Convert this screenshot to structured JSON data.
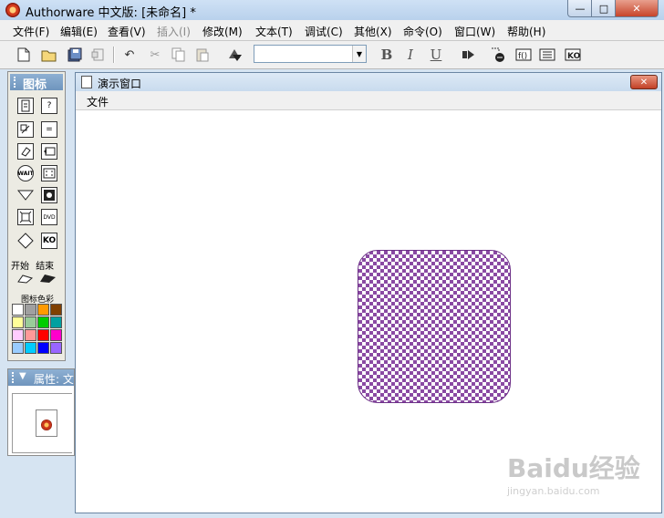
{
  "app": {
    "title": "Authorware 中文版: [未命名] *"
  },
  "window_controls": {
    "minimize": "—",
    "maximize": "□",
    "close": "✕"
  },
  "menu": [
    "文件(F)",
    "编辑(E)",
    "查看(V)",
    "插入(I)",
    "修改(M)",
    "文本(T)",
    "调试(C)",
    "其他(X)",
    "命令(O)",
    "窗口(W)",
    "帮助(H)"
  ],
  "toolbar": {
    "bold": "B",
    "italic": "I",
    "underline": "U",
    "font_value": "",
    "icons": [
      "new-icon",
      "open-icon",
      "save-all-icon",
      "import-icon",
      "undo-icon",
      "cut-icon",
      "copy-icon",
      "paste-icon",
      "find-icon",
      "run-icon",
      "control-panel-icon",
      "functions-icon",
      "variables-icon",
      "knowledge-objects-icon"
    ]
  },
  "palette": {
    "title": "图标",
    "start_label": "开始",
    "end_label": "结束",
    "colors_label": "图标色彩",
    "icons": [
      "display",
      "interaction",
      "motion",
      "calculate",
      "erase",
      "map",
      "wait",
      "digital-movie",
      "navigate",
      "sound",
      "framework",
      "dvd",
      "decision",
      "knowledge-object"
    ],
    "swatches": [
      "#ffffff",
      "#a0a0a0",
      "#ff9a00",
      "#804000",
      "#ffff99",
      "#99cc99",
      "#00cc00",
      "#00a0a0",
      "#ffccff",
      "#ff9999",
      "#ff0000",
      "#ff00cc",
      "#99ccff",
      "#00ccff",
      "#0000ff",
      "#9966ff"
    ]
  },
  "properties": {
    "title": "属性: 文"
  },
  "presentation_window": {
    "title": "演示窗口",
    "menu_file": "文件",
    "close": "✕"
  },
  "watermark": {
    "text": "Baidu经验",
    "url": "jingyan.baidu.com"
  }
}
